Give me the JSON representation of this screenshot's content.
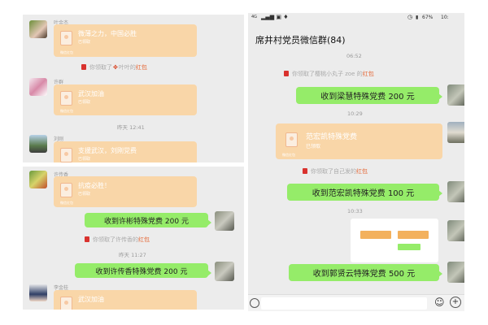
{
  "left_top": {
    "sender_1": "叶金杰",
    "rp_1_title": "微薄之力，中国必胜",
    "rp_1_sub": "已领取",
    "rp_1_foot": "微信红包",
    "sys_1_pre": "你领取了",
    "sys_1_name": "叶叶的",
    "sys_1_link": "红包",
    "sender_2": "许群",
    "rp_2_title": "武汉加油",
    "rp_2_sub": "已领取",
    "rp_2_foot": "微信红包",
    "time_1": "昨天 12:41",
    "sender_3": "刘刚",
    "rp_3_title": "支援武汉，刘刚党费",
    "rp_3_sub": "已领取"
  },
  "left_bottom": {
    "sender_1": "许传香",
    "rp_1_title": "抗疫必胜！",
    "rp_1_sub": "已领取",
    "rp_1_foot": "微信红包",
    "msg_1": "收到许彬特殊党费 200 元",
    "sys_1_pre": "你领取了许传香的",
    "sys_1_link": "红包",
    "time_1": "昨天 11:27",
    "msg_2": "收到许传香特殊党费 200 元",
    "sender_2": "李金桂",
    "rp_2_title": "武汉加油"
  },
  "right": {
    "status_left": "4G",
    "status_battery": "67%",
    "status_time": "10:",
    "title": "席井村党员微信群(84)",
    "time_1": "06:52",
    "sys_1_pre": "你领取了樱桃小丸子 zoe 的",
    "sys_1_link": "红包",
    "msg_1": "收到梁慧特殊党费 200 元",
    "time_2": "10:29",
    "rp_title": "范宏凯特殊党费",
    "rp_sub": "已领取",
    "rp_foot": "微信红包",
    "sys_2_pre": "你领取了自己发的",
    "sys_2_link": "红包",
    "msg_2": "收到范宏凯特殊党费 100 元",
    "time_3": "10:33",
    "msg_3": "收到郭贤云特殊党费 500 元"
  },
  "colors": {
    "bubble_green": "#95ec69",
    "red_packet": "#f9d6a8",
    "link_orange": "#e56a3a",
    "chat_bg": "#ececec"
  }
}
